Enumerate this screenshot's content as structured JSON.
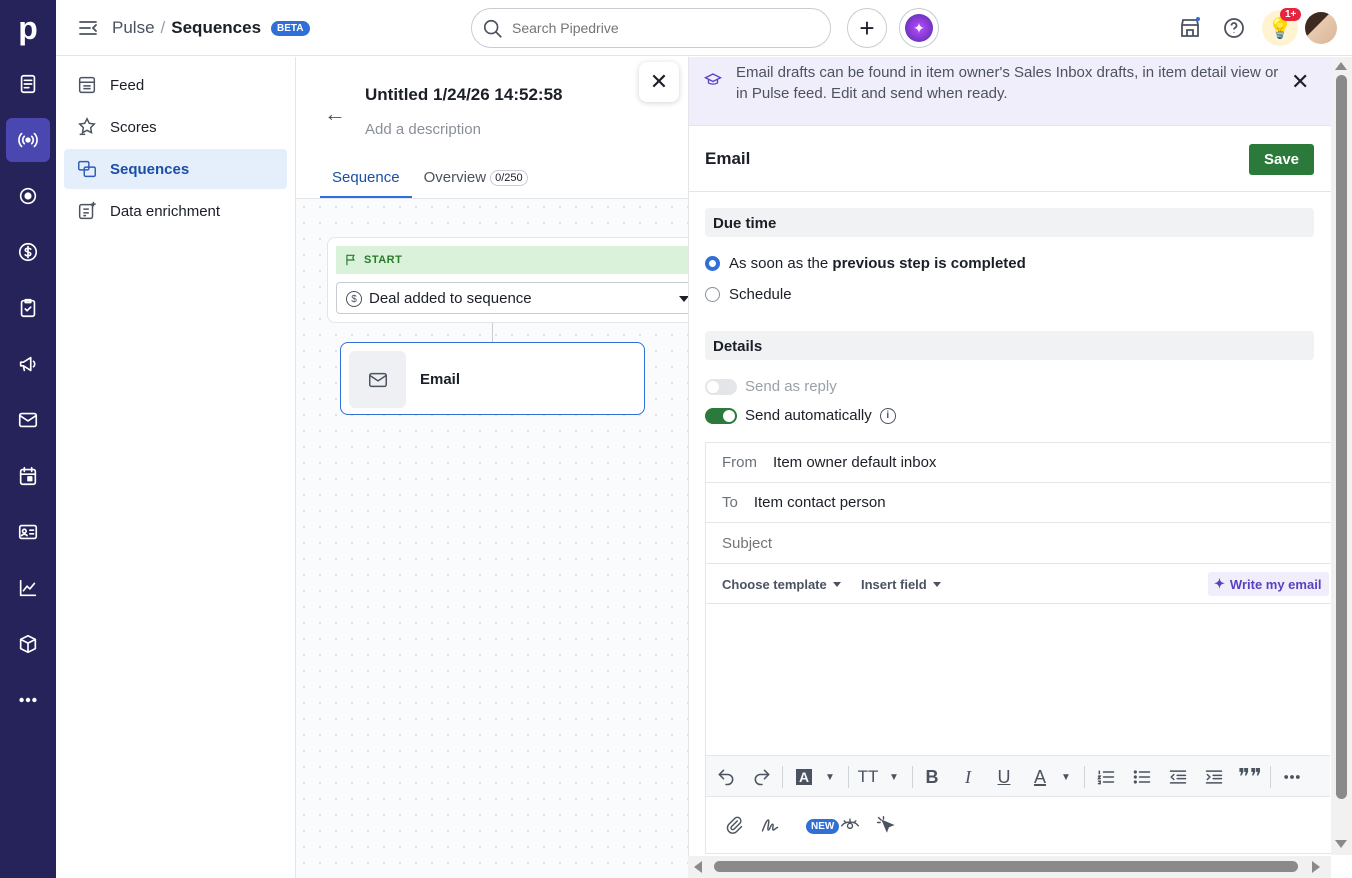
{
  "app": {
    "logo": "p"
  },
  "rail": {
    "items": [
      {
        "name": "leads-icon"
      },
      {
        "name": "pulse-icon",
        "active": true
      },
      {
        "name": "target-icon"
      },
      {
        "name": "deals-icon"
      },
      {
        "name": "tasks-icon"
      },
      {
        "name": "campaigns-icon"
      },
      {
        "name": "mail-icon"
      },
      {
        "name": "calendar-icon"
      },
      {
        "name": "contacts-icon"
      },
      {
        "name": "insights-icon"
      },
      {
        "name": "products-icon"
      },
      {
        "name": "more-icon"
      }
    ]
  },
  "topbar": {
    "breadcrumb_parent": "Pulse",
    "breadcrumb_sep": "/",
    "breadcrumb_current": "Sequences",
    "beta_badge": "BETA",
    "search_placeholder": "Search Pipedrive",
    "add_label": "+",
    "notif_count": "1+"
  },
  "subnav": {
    "items": [
      {
        "label": "Feed",
        "icon": "feed-icon"
      },
      {
        "label": "Scores",
        "icon": "scores-icon"
      },
      {
        "label": "Sequences",
        "icon": "sequences-icon",
        "active": true
      },
      {
        "label": "Data enrichment",
        "icon": "data-enrichment-icon"
      }
    ]
  },
  "sequence": {
    "title": "Untitled 1/24/26 14:52:58",
    "description_placeholder": "Add a description",
    "tabs": [
      {
        "label": "Sequence",
        "active": true
      },
      {
        "label": "Overview",
        "count": "0/250"
      }
    ],
    "start_label": "START",
    "trigger": "Deal added to sequence",
    "step_label": "Email"
  },
  "panel": {
    "banner_text": "Email drafts can be found in item owner's Sales Inbox drafts, in item detail view or in Pulse feed. Edit and send when ready.",
    "title": "Email",
    "save_label": "Save",
    "due_time_heading": "Due time",
    "radio_asap_prefix": "As soon as the ",
    "radio_asap_bold": "previous step is completed",
    "radio_schedule": "Schedule",
    "details_heading": "Details",
    "send_as_reply": "Send as reply",
    "send_automatically": "Send automatically",
    "from_label": "From",
    "from_value": "Item owner default inbox",
    "to_label": "To",
    "to_value": "Item contact person",
    "subject_placeholder": "Subject",
    "choose_template": "Choose template",
    "insert_field": "Insert field",
    "write_my_email": "Write my email",
    "new_badge": "NEW"
  },
  "colors": {
    "rail_bg": "#26235a",
    "accent_blue": "#2f6fd6",
    "save_green": "#2b7a3b",
    "banner_bg": "#f1eefc"
  }
}
